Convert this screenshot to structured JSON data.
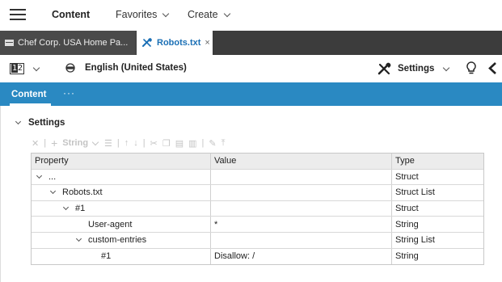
{
  "topbar": {
    "content_label": "Content",
    "favorites_label": "Favorites",
    "create_label": "Create"
  },
  "tabs": [
    {
      "label": "Chef Corp. USA Home Pa..."
    },
    {
      "label": "Robots.txt",
      "close": "×"
    }
  ],
  "toolbar": {
    "language": "English (United States)",
    "settings_label": "Settings"
  },
  "content_tab": {
    "label": "Content",
    "more": "···"
  },
  "settings": {
    "title": "Settings",
    "toolbar_string_label": "String"
  },
  "grid": {
    "headers": [
      "Property",
      "Value",
      "Type"
    ],
    "rows": [
      {
        "property": "...",
        "value": "",
        "type": "Struct",
        "indent": 0,
        "expander": true
      },
      {
        "property": "Robots.txt",
        "value": "",
        "type": "Struct List",
        "indent": 1,
        "expander": true
      },
      {
        "property": "#1",
        "value": "",
        "type": "Struct",
        "indent": 2,
        "expander": true
      },
      {
        "property": "User-agent",
        "value": "*",
        "type": "String",
        "indent": 3,
        "expander": false
      },
      {
        "property": "custom-entries",
        "value": "",
        "type": "String List",
        "indent": 3,
        "expander": true
      },
      {
        "property": "#1",
        "value": "Disallow: /",
        "type": "String",
        "indent": 4,
        "expander": false
      }
    ]
  },
  "colors": {
    "accent_blue": "#2a89c2",
    "tabbar_dark": "#3c3c3c",
    "active_tab_text": "#1a6fb5"
  }
}
